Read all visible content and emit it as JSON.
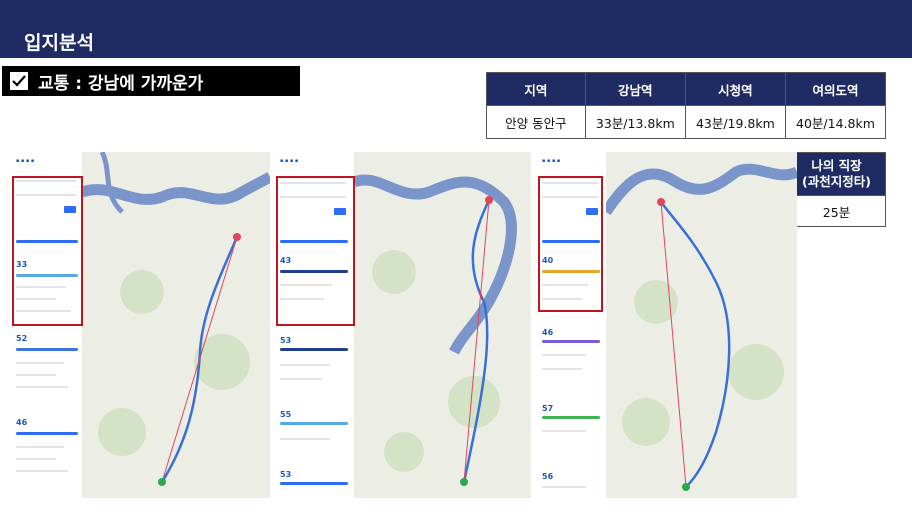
{
  "page": {
    "title": "입지분석"
  },
  "section": {
    "heading": "교통 : 강남에 가까운가",
    "check_icon": "checkmark-icon"
  },
  "commute_table": {
    "headers": [
      "지역",
      "강남역",
      "시청역",
      "여의도역"
    ],
    "row": [
      "안양 동안구",
      "33분/13.8km",
      "43분/19.8km",
      "40분/14.8km"
    ]
  },
  "work_table": {
    "header": "나의 직장\n(과천지정타)",
    "value": "25분"
  },
  "screens": [
    {
      "total_time": "33",
      "alt_times": [
        "52",
        "46"
      ]
    },
    {
      "total_time": "43",
      "alt_times": [
        "53",
        "55",
        "53"
      ]
    },
    {
      "total_time": "40",
      "alt_times": [
        "46",
        "57",
        "56"
      ]
    }
  ],
  "colors": {
    "navy": "#1f2c64",
    "highlight_red": "#c0141e",
    "route_blue": "#3a6fd8",
    "river": "#7a95c9"
  }
}
